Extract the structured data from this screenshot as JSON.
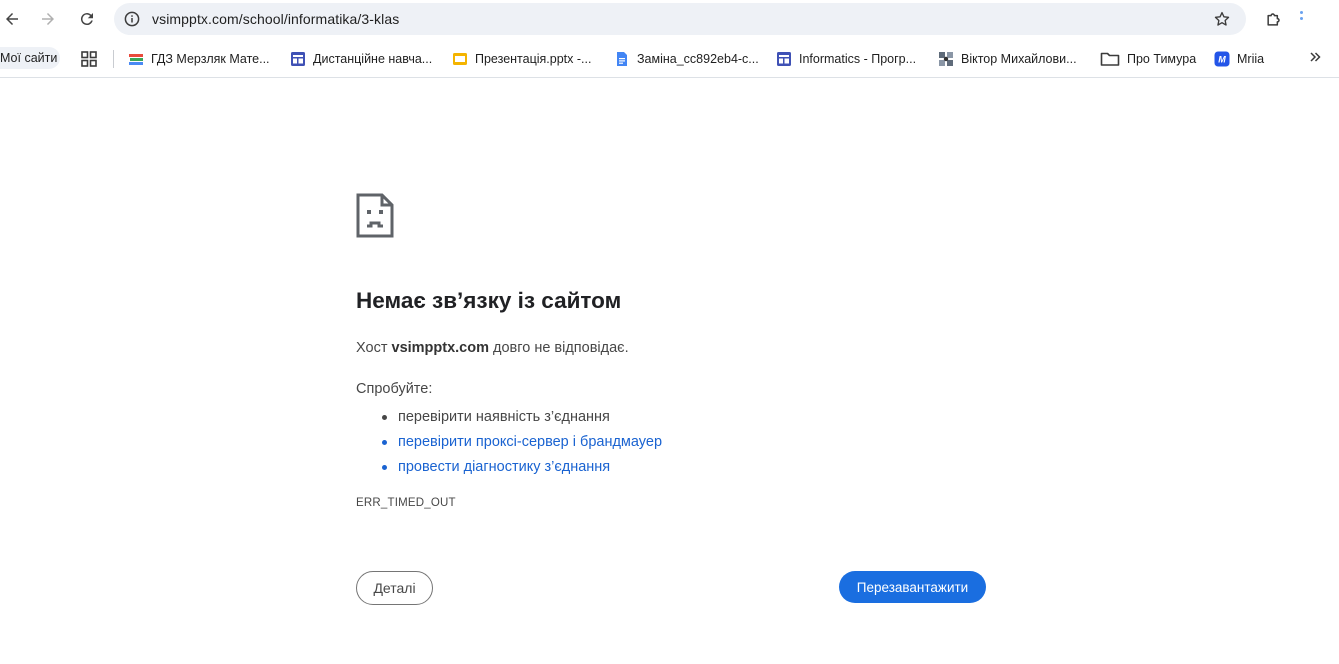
{
  "toolbar": {
    "url": "vsimpptx.com/school/informatika/3-klas",
    "back_icon": "arrow-left-icon",
    "forward_icon": "arrow-right-icon",
    "reload_icon": "reload-icon",
    "site_info_icon": "info-icon",
    "bookmark_star_icon": "star-icon",
    "extensions_icon": "puzzle-icon"
  },
  "bookmarks": {
    "my_sites": "Мої сайти",
    "items": [
      {
        "label": "ГДЗ Мерзляк Мате...",
        "icon": "books-icon"
      },
      {
        "label": "Дистанційне навча...",
        "icon": "sites-icon"
      },
      {
        "label": "Презентація.pptx -...",
        "icon": "slides-icon"
      },
      {
        "label": "Заміна_cc892eb4-c...",
        "icon": "docs-icon"
      },
      {
        "label": "Informatics - Прогр...",
        "icon": "sites-icon"
      },
      {
        "label": "Віктор Михайлови...",
        "icon": "tile-icon"
      },
      {
        "label": "Про Тимура",
        "icon": "folder-icon"
      },
      {
        "label": "Mriia",
        "icon": "mriia-icon"
      }
    ]
  },
  "error": {
    "title": "Немає зв’язку із сайтом",
    "desc_prefix": "Хост ",
    "desc_host": "vsimpptx.com",
    "desc_suffix": " довго не відповідає.",
    "try_label": "Спробуйте:",
    "suggestions": [
      "перевірити наявність з’єднання",
      "перевірити проксі-сервер і брандмауер",
      "провести діагностику з’єднання"
    ],
    "code": "ERR_TIMED_OUT",
    "details_button": "Деталі",
    "reload_button": "Перезавантажити"
  },
  "colors": {
    "accent": "#1a6ee0",
    "link": "#1a63d1",
    "omnibox_bg": "#eef1f6"
  }
}
